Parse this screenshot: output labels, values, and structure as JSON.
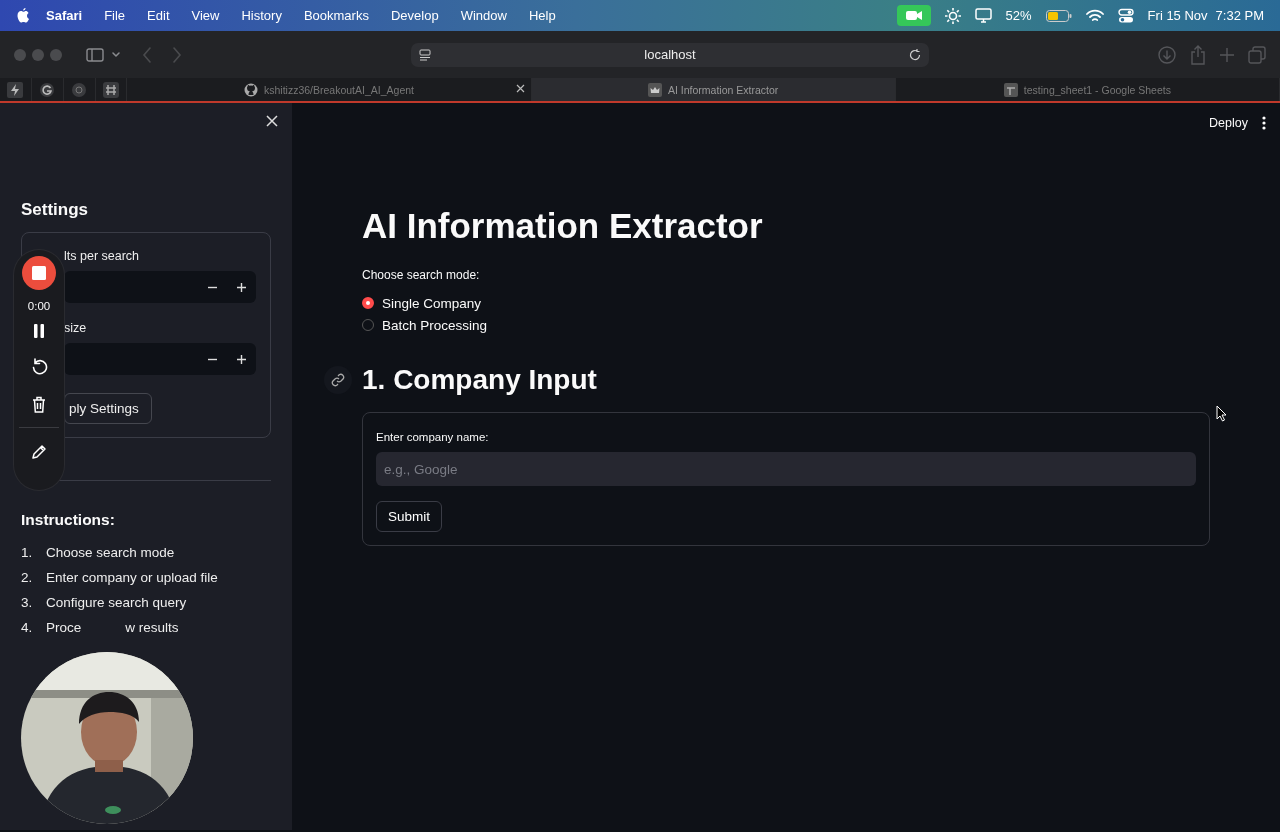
{
  "menu_bar": {
    "app": "Safari",
    "menus": [
      "File",
      "Edit",
      "View",
      "History",
      "Bookmarks",
      "Develop",
      "Window",
      "Help"
    ],
    "battery": "52%",
    "date": "Fri 15 Nov",
    "time": "7:32 PM"
  },
  "browser": {
    "address": "localhost",
    "tabs": [
      {
        "title": "kshitizz36/BreakoutAI_AI_Agent",
        "selected": false
      },
      {
        "title": "AI Information Extractor",
        "selected": true
      },
      {
        "title": "testing_sheet1 - Google Sheets",
        "selected": false
      }
    ]
  },
  "sidebar": {
    "title": "Settings",
    "fields": [
      {
        "label": "lts per search"
      },
      {
        "label": "size"
      }
    ],
    "apply_button": "ply Settings",
    "instructions_title": "Instructions:",
    "steps": [
      {
        "number": "1.",
        "parts": [
          "Choose search mode"
        ]
      },
      {
        "number": "2.",
        "parts": [
          "Enter company or upload file"
        ]
      },
      {
        "number": "3.",
        "parts": [
          "Configure search query"
        ]
      },
      {
        "number": "4.",
        "parts": [
          "Proce",
          "w results"
        ]
      }
    ]
  },
  "recorder": {
    "timer": "0:00"
  },
  "header": {
    "deploy": "Deploy"
  },
  "main": {
    "title": "AI Information Extractor",
    "mode_label": "Choose search mode:",
    "modes": [
      {
        "label": "Single Company",
        "selected": true
      },
      {
        "label": "Batch Processing",
        "selected": false
      }
    ],
    "section_title": "1. Company Input",
    "form": {
      "label": "Enter company name:",
      "placeholder": "e.g., Google",
      "submit": "Submit"
    }
  }
}
